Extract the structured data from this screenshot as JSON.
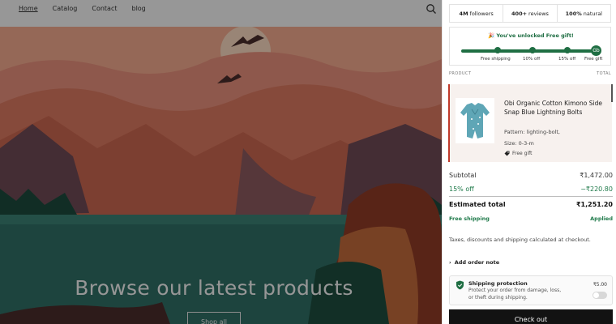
{
  "nav": {
    "items": [
      "Home",
      "Catalog",
      "Contact",
      "blog"
    ],
    "active": "Home"
  },
  "hero": {
    "title": "Browse our latest products",
    "button": "Shop all"
  },
  "stats": [
    {
      "value": "4M",
      "label": "followers"
    },
    {
      "value": "400+",
      "label": "reviews"
    },
    {
      "value": "100%",
      "label": "natural"
    }
  ],
  "rewards": {
    "message": "🎉 You've unlocked Free gift!",
    "milestones": [
      "Free shipping",
      "10% off",
      "15% off",
      "Free gift"
    ],
    "progress_percent": 100,
    "gift_icon_text": "Gb"
  },
  "columns": {
    "product": "PRODUCT",
    "total": "TOTAL"
  },
  "item": {
    "title": "Obi Organic Cotton Kimono Side Snap Blue Lightning Bolts",
    "pattern": "Pattern: lighting-bolt,",
    "size": "Size: 0-3-m",
    "gift_tag": "Free gift"
  },
  "summary": {
    "subtotal_label": "Subtotal",
    "subtotal_value": "₹1,472.00",
    "discount_label": "15% off",
    "discount_value": "−₹220.80",
    "estimated_label": "Estimated total",
    "estimated_value": "₹1,251.20",
    "shipping_label": "Free shipping",
    "shipping_value": "Applied",
    "taxes_note": "Taxes, discounts and shipping calculated at checkout."
  },
  "order_note": "Add order note",
  "protection": {
    "title": "Shipping protection",
    "description": "Protect your order from damage, loss, or theft during shipping.",
    "price": "₹5.00",
    "enabled": false
  },
  "checkout": "Check out",
  "colors": {
    "accent_green": "#1f6e43",
    "item_highlight": "#c0392b",
    "checkout_bg": "#121212"
  }
}
